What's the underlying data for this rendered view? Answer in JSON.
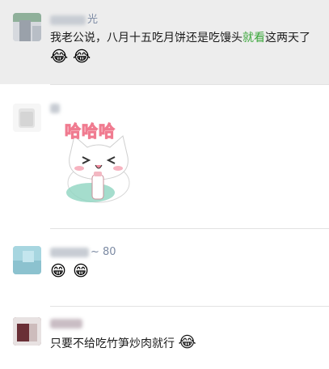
{
  "comments": [
    {
      "name_visible": "光",
      "text_before": "我老公说，八月十五吃月饼还是吃馒头",
      "text_highlight": "就看",
      "text_after": "这两天了",
      "emojis": [
        "😂",
        "😂"
      ],
      "highlight_color": "#3aa63a"
    },
    {
      "name_visible": "",
      "sticker_text": "哈哈哈",
      "sticker_label": "喝奶"
    },
    {
      "name_visible": "~ 80",
      "emojis": [
        "😁",
        "😁"
      ]
    },
    {
      "name_visible": "",
      "text": "只要不给吃竹笋炒肉就行",
      "emojis": [
        "😂"
      ]
    }
  ],
  "colors": {
    "selected_bg": "#ededed",
    "name_color": "#7c8aa3",
    "separator": "#e2e2e2"
  }
}
